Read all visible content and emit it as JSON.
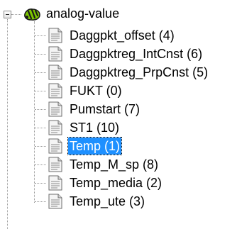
{
  "tree": {
    "root": {
      "label": "analog-value",
      "icon": "folder-puzzle-icon",
      "expanded": true
    },
    "items": [
      {
        "label": "Daggpkt_offset (4)",
        "icon": "document-icon",
        "selected": false
      },
      {
        "label": "Daggpktreg_IntCnst (6)",
        "icon": "document-icon",
        "selected": false
      },
      {
        "label": "Daggpktreg_PrpCnst (5)",
        "icon": "document-icon",
        "selected": false
      },
      {
        "label": "FUKT (0)",
        "icon": "document-icon",
        "selected": false
      },
      {
        "label": "Pumstart (7)",
        "icon": "document-icon",
        "selected": false
      },
      {
        "label": "ST1 (10)",
        "icon": "document-icon",
        "selected": false
      },
      {
        "label": "Temp (1)",
        "icon": "document-icon",
        "selected": true
      },
      {
        "label": "Temp_M_sp (8)",
        "icon": "document-icon",
        "selected": false
      },
      {
        "label": "Temp_media (2)",
        "icon": "document-icon",
        "selected": false
      },
      {
        "label": "Temp_ute (3)",
        "icon": "document-icon",
        "selected": false
      }
    ],
    "colors": {
      "selection": "#1e90ff",
      "selection_text": "#ffffff",
      "tree_lines": "#9a9a9a",
      "root_icon_body": "#7ec800",
      "root_icon_outline": "#1a1a1a"
    }
  }
}
